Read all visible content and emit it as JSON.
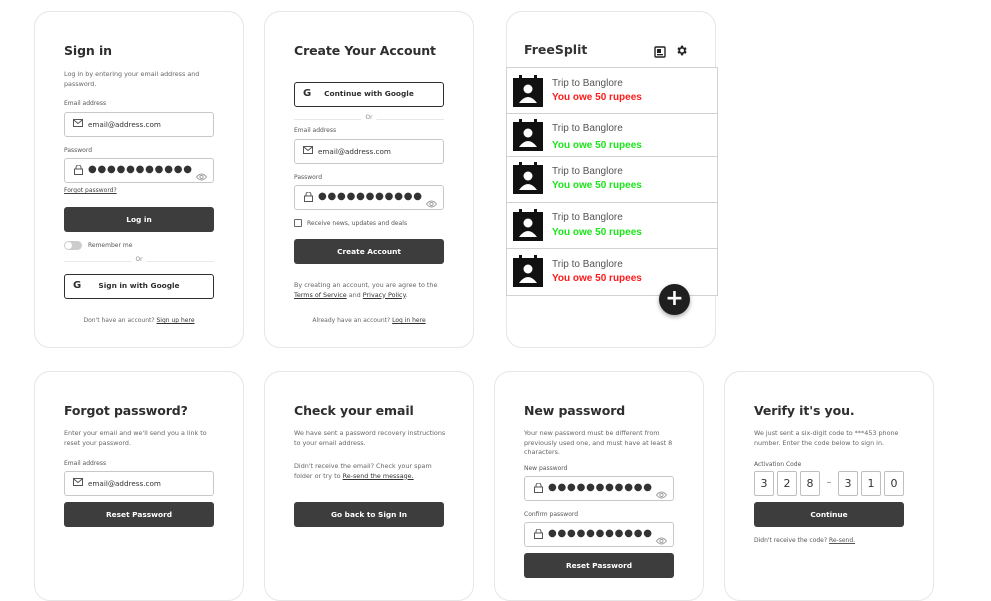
{
  "signin": {
    "title": "Sign in",
    "desc": "Log in by entering your email address and password.",
    "email_label": "Email address",
    "email_value": "email@address.com",
    "password_label": "Password",
    "password_value": "●●●●●●●●●●●",
    "forgot": "Forgot password?",
    "login_btn": "Log in",
    "remember": "Remember me",
    "or": "Or",
    "google_btn": "Sign in with Google",
    "footer_text": "Don't have an account?",
    "footer_link": "Sign up here"
  },
  "create": {
    "title": "Create Your Account",
    "google_btn": "Continue with Google",
    "or": "Or",
    "email_label": "Email address",
    "email_value": "email@address.com",
    "password_label": "Password",
    "password_value": "●●●●●●●●●●●",
    "news": "Receive news, updates and deals",
    "create_btn": "Create Account",
    "terms_text": "By creating an account, you are agree to the",
    "terms_link": "Terms of Service",
    "and": "and",
    "privacy_link": "Privacy Policy",
    "footer_text": "Already have an account?",
    "footer_link": "Log in here"
  },
  "freesplit": {
    "title": "FreeSplit",
    "items": [
      {
        "name": "Trip to Banglore",
        "amount": "You owe 50 rupees",
        "color": "#ff1a1a"
      },
      {
        "name": "Trip to Banglore",
        "amount": "You owe 50 rupees",
        "color": "#19e619"
      },
      {
        "name": "Trip to Banglore",
        "amount": "You owe 50 rupees",
        "color": "#19e619"
      },
      {
        "name": "Trip to Banglore",
        "amount": "You owe 50 rupees",
        "color": "#19e619"
      },
      {
        "name": "Trip to Banglore",
        "amount": "You owe 50 rupees",
        "color": "#ff1a1a"
      }
    ],
    "fab": "+"
  },
  "forgot": {
    "title": "Forgot password?",
    "desc": "Enter your email and we'll send you a link to reset your password.",
    "email_label": "Email address",
    "email_value": "email@address.com",
    "btn": "Reset Password"
  },
  "check": {
    "title": "Check your email",
    "desc": "We have sent a password recovery instructions to your email address.",
    "resend_text": "Didn't receive the email? Check your spam folder or try to",
    "resend_link": "Re-send the message.",
    "btn": "Go back to Sign In"
  },
  "newpass": {
    "title": "New password",
    "desc": "Your new password must be different from previously used one, and must have at least 8 characters.",
    "new_label": "New password",
    "new_value": "●●●●●●●●●●●",
    "confirm_label": "Confirm password",
    "confirm_value": "●●●●●●●●●●●",
    "btn": "Reset Password"
  },
  "verify": {
    "title": "Verify it's you.",
    "desc": "We just sent a six-digit code to ***453 phone number. Enter the code below to sign in.",
    "code_label": "Activation Code",
    "digits": [
      "3",
      "2",
      "8",
      "3",
      "1",
      "0"
    ],
    "dash": "–",
    "btn": "Continue",
    "resend_text": "Didn't receive the code?",
    "resend_link": "Re-send."
  },
  "icons": {
    "mail": "envelope-icon",
    "lock": "lock-icon",
    "eye": "eye-icon",
    "google": "google-g-icon",
    "settings": "gear-icon",
    "book": "book-icon",
    "avatar": "calendar-person-icon"
  }
}
